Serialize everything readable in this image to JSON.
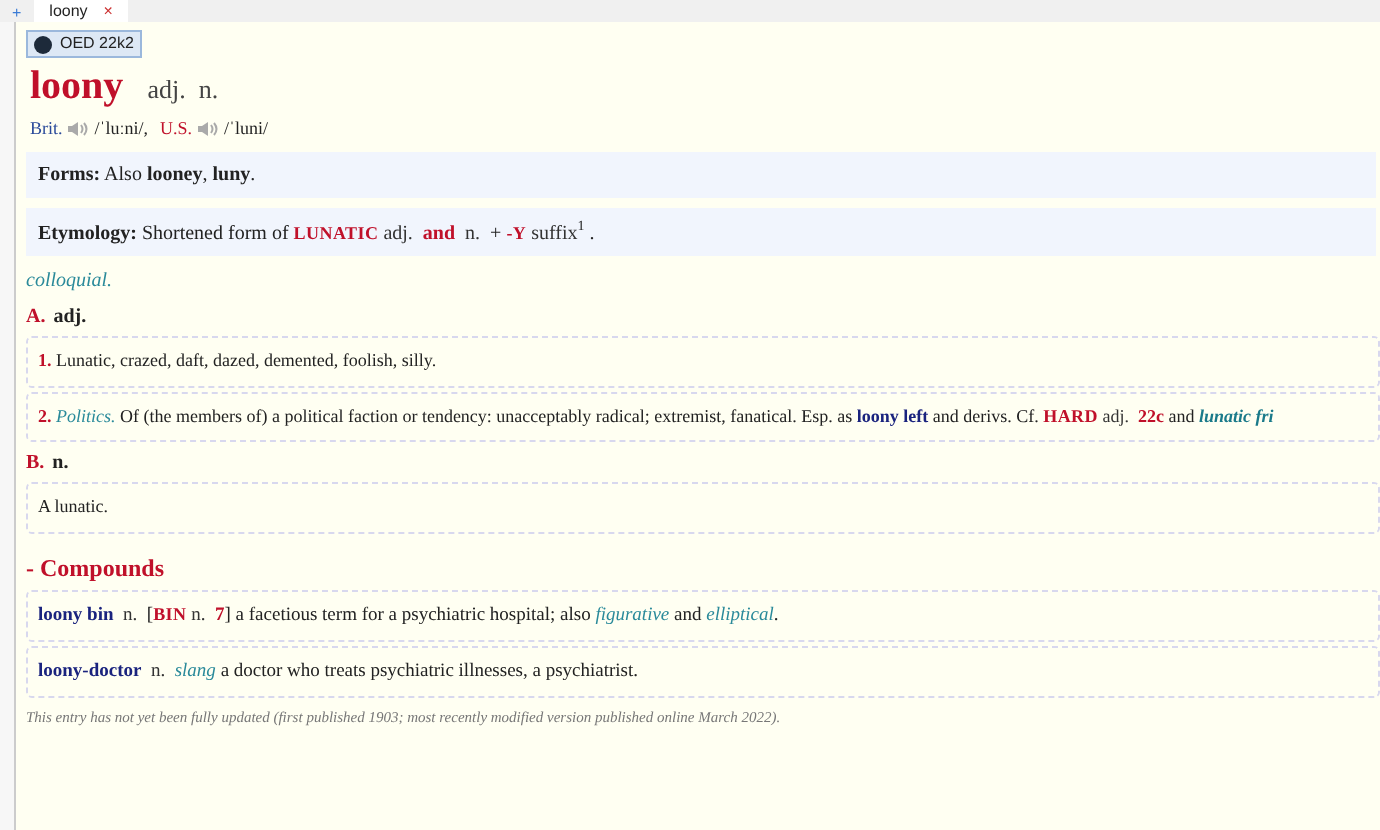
{
  "tab_bar": {
    "new_tab": "+",
    "tabs": [
      {
        "label": "loony",
        "close": "×",
        "selected": true
      }
    ]
  },
  "source_badge": {
    "label": "OED 22k2"
  },
  "headword": {
    "word": "loony",
    "pos": "adj.  n."
  },
  "pronunciation": [
    {
      "region": "Brit.",
      "ipa": "/ˈluːni/,",
      "kind": "brit"
    },
    {
      "region": "U.S.",
      "ipa": "/ˈluni/",
      "kind": "us"
    }
  ],
  "forms": [
    {
      "t": "Forms:",
      "kind": "head"
    },
    {
      "t": " Also ",
      "kind": "plain"
    },
    {
      "t": "looney",
      "kind": "bold"
    },
    {
      "t": ", ",
      "kind": "plain"
    },
    {
      "t": "luny",
      "kind": "bold"
    },
    {
      "t": ".",
      "kind": "plain"
    }
  ],
  "etymology": [
    {
      "t": "Etymology:",
      "kind": "head"
    },
    {
      "t": " Shortened form of ",
      "kind": "plain"
    },
    {
      "t": "LUNATIC",
      "kind": "xref"
    },
    {
      "t": " adj. ",
      "kind": "pos"
    },
    {
      "t": " and ",
      "kind": "redbold"
    },
    {
      "t": " n. ",
      "kind": "pos"
    },
    {
      "t": " + ",
      "kind": "plain"
    },
    {
      "t": "-Y",
      "kind": "xref"
    },
    {
      "t": " suffix",
      "kind": "pos"
    },
    {
      "t": "1",
      "kind": "sup"
    },
    {
      "t": " .",
      "kind": "plain"
    }
  ],
  "usage_label": "colloquial.",
  "sections": [
    {
      "letter": "A.",
      "pos": "adj.",
      "senses": [
        [
          {
            "t": "1.",
            "kind": "num"
          },
          {
            "t": " Lunatic, crazed, daft, dazed, demented, foolish, silly.",
            "kind": "plain"
          }
        ],
        [
          {
            "t": "2. ",
            "kind": "num"
          },
          {
            "t": "Politics.",
            "kind": "label"
          },
          {
            "t": " Of (the members of) a political faction or tendency: unacceptably radical; extremist, fanatical. Esp. as ",
            "kind": "plain"
          },
          {
            "t": "loony left",
            "kind": "strong"
          },
          {
            "t": " and derivs. Cf. ",
            "kind": "plain"
          },
          {
            "t": "HARD",
            "kind": "xref"
          },
          {
            "t": " adj. ",
            "kind": "pos"
          },
          {
            "t": " 22c",
            "kind": "redbold"
          },
          {
            "t": " and ",
            "kind": "plain"
          },
          {
            "t": "lunatic fri",
            "kind": "labellink"
          }
        ]
      ]
    },
    {
      "letter": "B.",
      "pos": "n.",
      "senses": [
        [
          {
            "t": "A lunatic.",
            "kind": "plain"
          }
        ]
      ]
    }
  ],
  "compounds": {
    "heading": "- Compounds",
    "items": [
      [
        {
          "t": "loony bin",
          "kind": "strong"
        },
        {
          "t": "  n. ",
          "kind": "pos"
        },
        {
          "t": " [",
          "kind": "plain"
        },
        {
          "t": "BIN",
          "kind": "xref"
        },
        {
          "t": " n. ",
          "kind": "pos"
        },
        {
          "t": " 7",
          "kind": "redbold"
        },
        {
          "t": "] a facetious term for a psychiatric hospital; also ",
          "kind": "plain"
        },
        {
          "t": "figurative",
          "kind": "label"
        },
        {
          "t": " and ",
          "kind": "plain"
        },
        {
          "t": "elliptical",
          "kind": "label"
        },
        {
          "t": ".",
          "kind": "plain"
        }
      ],
      [
        {
          "t": "loony-doctor",
          "kind": "strong"
        },
        {
          "t": "  n.  ",
          "kind": "pos"
        },
        {
          "t": "slang",
          "kind": "label"
        },
        {
          "t": " a doctor who treats psychiatric illnesses, a psychiatrist.",
          "kind": "plain"
        }
      ]
    ]
  },
  "footnote": "This entry has not yet been fully updated (first published 1903; most recently modified version published online March 2022)."
}
